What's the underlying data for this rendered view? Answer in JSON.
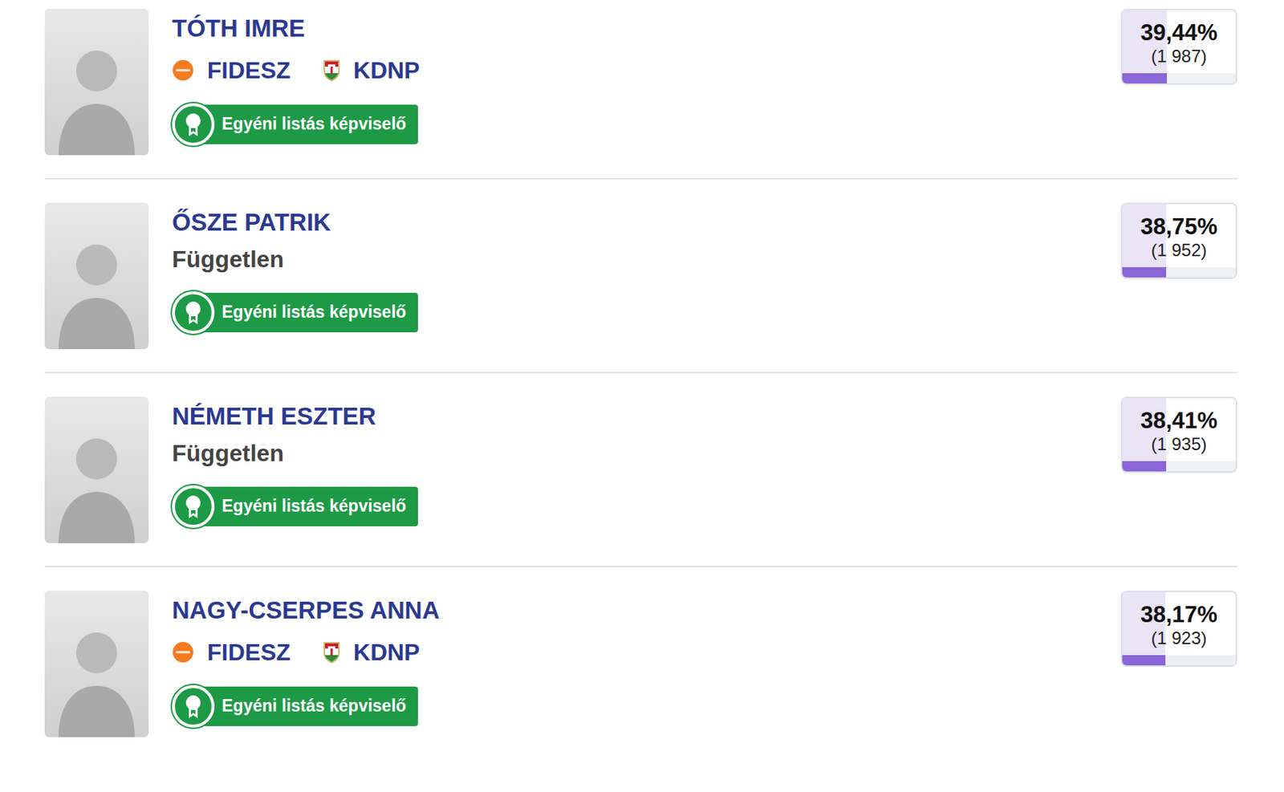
{
  "candidates": [
    {
      "name": "TÓTH IMRE",
      "affiliation": {
        "kind": "parties",
        "parties": [
          {
            "label": "FIDESZ",
            "kind": "fidesz"
          },
          {
            "label": "KDNP",
            "kind": "kdnp"
          }
        ]
      },
      "badge": "Egyéni listás képviselő",
      "percent": "39,44%",
      "votes": "(1 987)",
      "level": 0.3944
    },
    {
      "name": "ŐSZE PATRIK",
      "affiliation": {
        "kind": "independent",
        "label": "Független"
      },
      "badge": "Egyéni listás képviselő",
      "percent": "38,75%",
      "votes": "(1 952)",
      "level": 0.3875
    },
    {
      "name": "NÉMETH ESZTER",
      "affiliation": {
        "kind": "independent",
        "label": "Független"
      },
      "badge": "Egyéni listás képviselő",
      "percent": "38,41%",
      "votes": "(1 935)",
      "level": 0.3841
    },
    {
      "name": "NAGY-CSERPES ANNA",
      "affiliation": {
        "kind": "parties",
        "parties": [
          {
            "label": "FIDESZ",
            "kind": "fidesz"
          },
          {
            "label": "KDNP",
            "kind": "kdnp"
          }
        ]
      },
      "badge": "Egyéni listás képviselő",
      "percent": "38,17%",
      "votes": "(1 923)",
      "level": 0.3817
    }
  ]
}
